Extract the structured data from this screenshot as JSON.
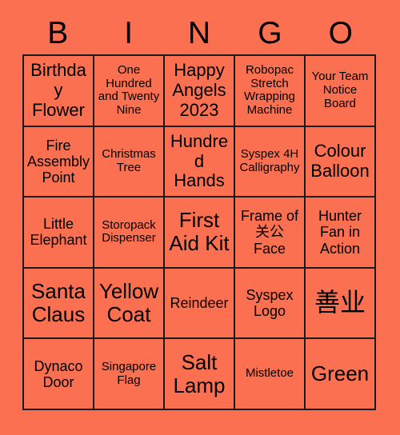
{
  "card": {
    "background_color": "#fb7050",
    "border_color": "#1a1a1a",
    "text_color": "#000000",
    "header": {
      "letters": [
        "B",
        "I",
        "N",
        "G",
        "O"
      ]
    },
    "columns": 5,
    "rows": 5,
    "cells": [
      {
        "text": "Birthday Flower",
        "size": "large"
      },
      {
        "text": "One Hundred and Twenty Nine",
        "size": "small"
      },
      {
        "text": "Happy Angels 2023",
        "size": "large"
      },
      {
        "text": "Robopac Stretch Wrapping Machine",
        "size": "small"
      },
      {
        "text": "Your Team Notice Board",
        "size": "small"
      },
      {
        "text": "Fire Assembly Point",
        "size": "medium"
      },
      {
        "text": "Christmas Tree",
        "size": "small"
      },
      {
        "text": "Hundred Hands",
        "size": "large"
      },
      {
        "text": "Syspex 4H Calligraphy",
        "size": "small"
      },
      {
        "text": "Colour Balloon",
        "size": "large"
      },
      {
        "text": "Little Elephant",
        "size": "medium"
      },
      {
        "text": "Storopack Dispenser",
        "size": "small"
      },
      {
        "text": "First Aid Kit",
        "size": "xlarge"
      },
      {
        "text": "Frame of 关公 Face",
        "size": "medium"
      },
      {
        "text": "Hunter Fan in Action",
        "size": "medium"
      },
      {
        "text": "Santa Claus",
        "size": "xlarge"
      },
      {
        "text": "Yellow Coat",
        "size": "xlarge"
      },
      {
        "text": "Reindeer",
        "size": "medium"
      },
      {
        "text": "Syspex Logo",
        "size": "medium"
      },
      {
        "text": "善业",
        "size": "cjk"
      },
      {
        "text": "Dynaco Door",
        "size": "medium"
      },
      {
        "text": "Singapore Flag",
        "size": "small"
      },
      {
        "text": "Salt Lamp",
        "size": "xlarge"
      },
      {
        "text": "Mistletoe",
        "size": "small"
      },
      {
        "text": "Green",
        "size": "xlarge"
      }
    ]
  }
}
